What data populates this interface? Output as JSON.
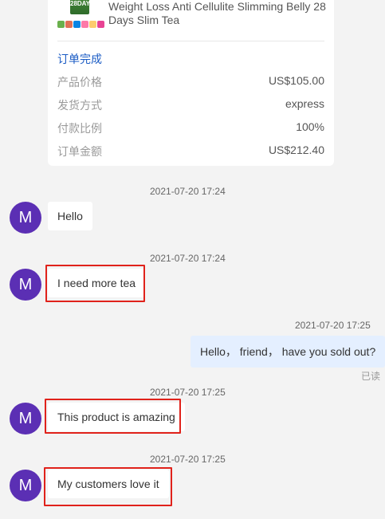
{
  "product": {
    "thumb_text": "28DAY",
    "title": "Weight Loss Anti Cellulite Slimming Belly 28 Days Slim Tea"
  },
  "order": {
    "status": "订单完成",
    "rows": [
      {
        "label": "产品价格",
        "value": "US$105.00"
      },
      {
        "label": "发货方式",
        "value": "express"
      },
      {
        "label": "付款比例",
        "value": "100%"
      },
      {
        "label": "订单金额",
        "value": "US$212.40"
      }
    ]
  },
  "messages": [
    {
      "avatar": "M",
      "time": "2021-07-20 17:24",
      "text": "Hello",
      "side": "left"
    },
    {
      "avatar": "M",
      "time": "2021-07-20 17:24",
      "text": "I need more tea",
      "side": "left"
    },
    {
      "time": "2021-07-20 17:25",
      "text": "Hello， friend， have you sold out?",
      "side": "right",
      "receipt": "已读"
    },
    {
      "avatar": "M",
      "time": "2021-07-20 17:25",
      "text": "This product is amazing",
      "side": "left"
    },
    {
      "avatar": "M",
      "time": "2021-07-20 17:25",
      "text": "My customers love it",
      "side": "left"
    }
  ],
  "colors": {
    "avatar": "#5b2fb4",
    "status_link": "#1a5bc4",
    "highlight": "#e0221b",
    "own_bubble": "#e4efff"
  }
}
